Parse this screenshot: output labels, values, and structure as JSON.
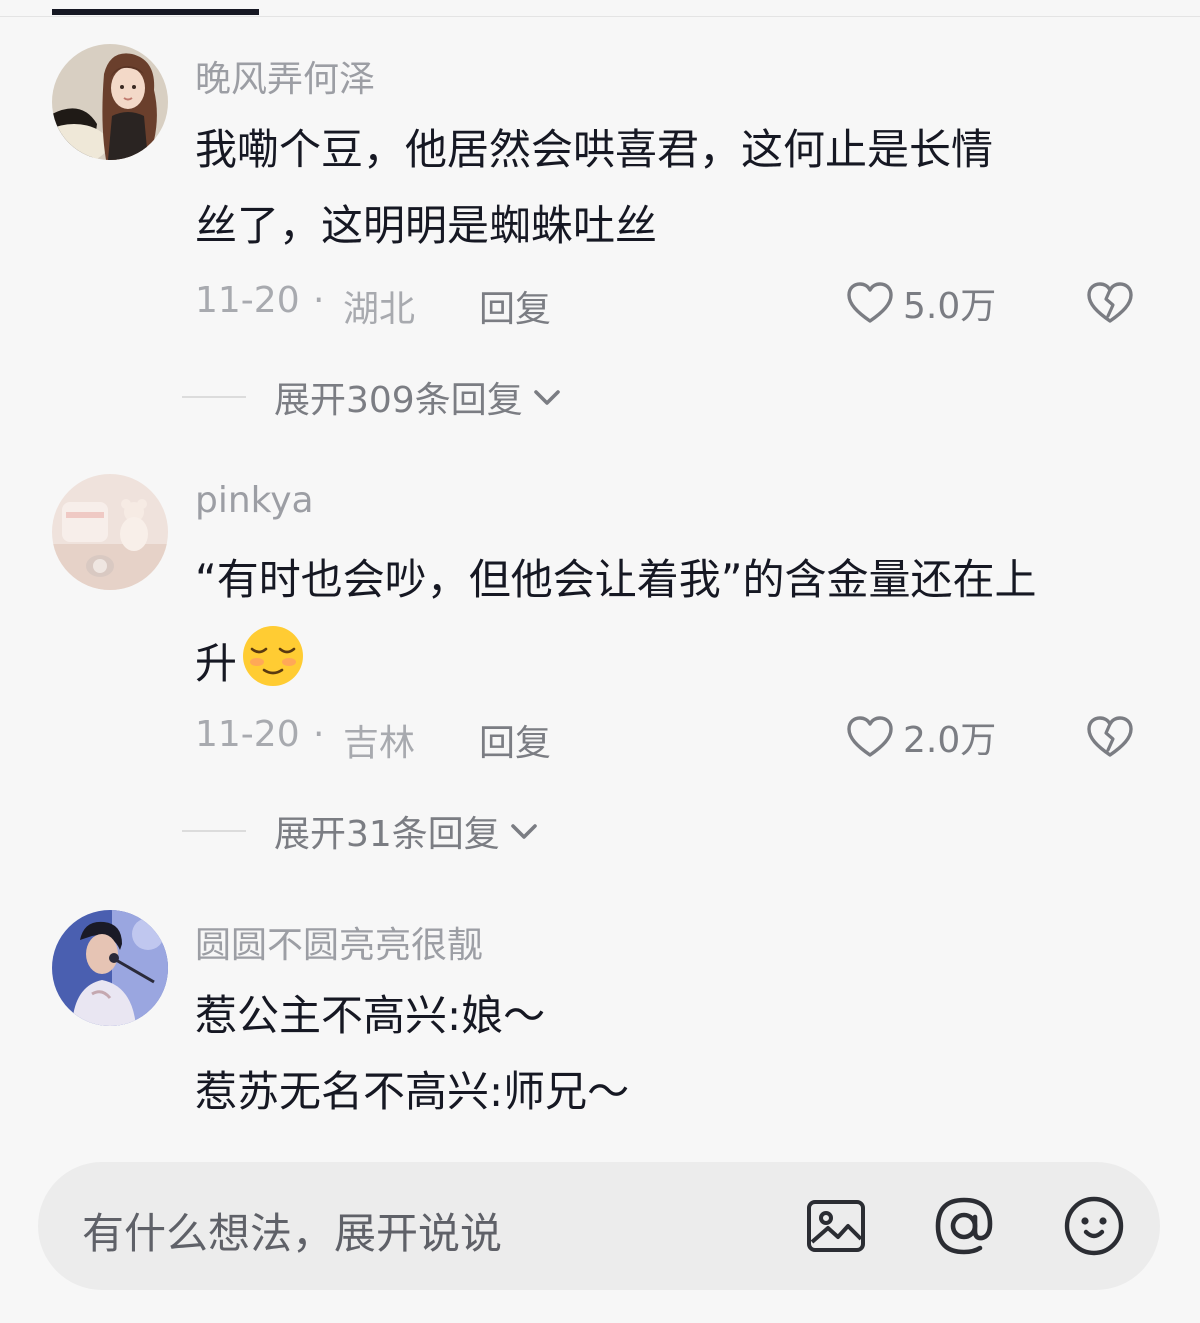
{
  "comments": [
    {
      "username": "晚风弄何泽",
      "content_lines": [
        "我嘞个豆，他居然会哄喜君，这何止是长情",
        "丝了，这明明是蜘蛛吐丝"
      ],
      "date": "11-20",
      "separator": "·",
      "location": "湖北",
      "reply_label": "回复",
      "like_count": "5.0万",
      "expand_label": "展开309条回复"
    },
    {
      "username": "pinkya",
      "content_lines": [
        "“有时也会吵，但他会让着我”的含金量还在上",
        "升"
      ],
      "emoji": "relieved-face",
      "date": "11-20",
      "separator": "·",
      "location": "吉林",
      "reply_label": "回复",
      "like_count": "2.0万",
      "expand_label": "展开31条回复"
    },
    {
      "username": "圆圆不圆亮亮很靓",
      "content_lines": [
        "惹公主不高兴:娘～",
        "惹苏无名不高兴:师兄～"
      ]
    }
  ],
  "input_bar": {
    "placeholder": "有什么想法，展开说说",
    "icons": [
      "image-icon",
      "at-icon",
      "smile-icon"
    ]
  },
  "colors": {
    "text_primary": "#161823",
    "text_secondary": "#9c9ea4",
    "background": "#f7f7f7",
    "input_background": "#ececec"
  }
}
